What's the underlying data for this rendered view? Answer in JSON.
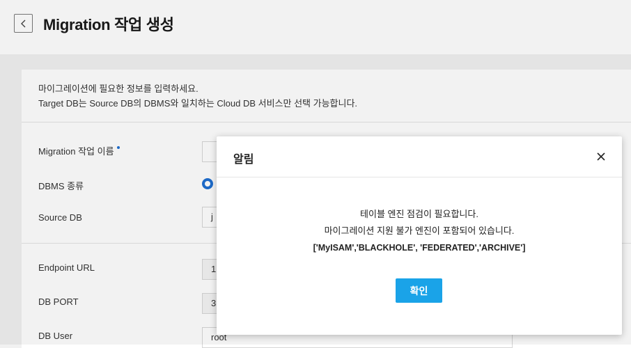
{
  "header": {
    "back_icon": "chevron-left-icon",
    "title": "Migration 작업 생성"
  },
  "intro": {
    "line1": "마이그레이션에 필요한 정보를 입력하세요.",
    "line2": "Target DB는 Source DB의 DBMS와 일치하는 Cloud DB 서비스만 선택 가능합니다."
  },
  "form": {
    "job_name_label": "Migration 작업 이름",
    "dbms_label": "DBMS 종류",
    "source_db_label": "Source DB",
    "source_db_value": "j",
    "endpoint_label": "Endpoint URL",
    "endpoint_value": "1",
    "port_label": "DB PORT",
    "port_value": "3",
    "user_label": "DB User",
    "user_value": "root"
  },
  "modal": {
    "title": "알림",
    "close_icon": "close-icon",
    "message_line1": "테이블 엔진 점검이 필요합니다.",
    "message_line2": "마이그레이션 지원 불가 엔진이 포함되어 있습니다.",
    "engines": "['MyISAM','BLACKHOLE', 'FEDERATED','ARCHIVE']",
    "confirm_label": "확인"
  },
  "colors": {
    "accent": "#1aa3e8",
    "radio": "#1f6fd1"
  }
}
